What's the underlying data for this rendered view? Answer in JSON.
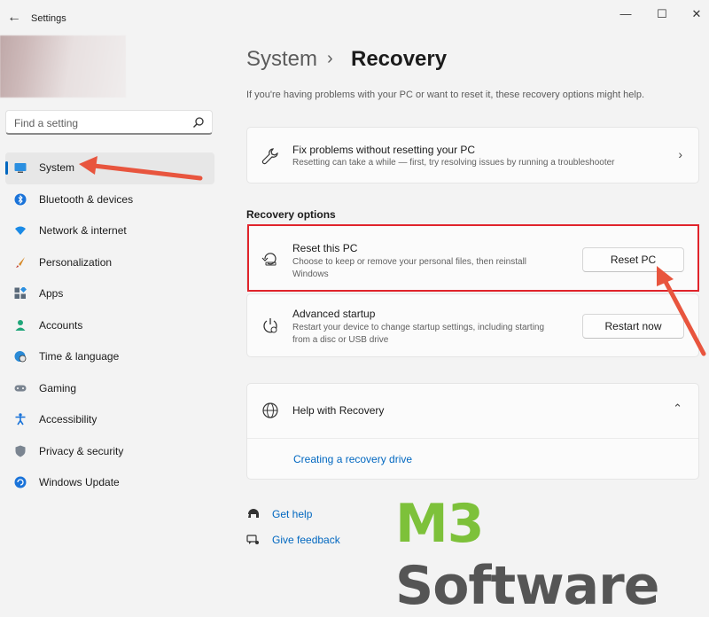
{
  "window": {
    "title": "Settings",
    "back_glyph": "←",
    "minimize_glyph": "—",
    "maximize_glyph": "☐",
    "close_glyph": "✕"
  },
  "search": {
    "placeholder": "Find a setting"
  },
  "sidebar": {
    "items": [
      {
        "label": "System",
        "icon": "monitor-icon",
        "active": true
      },
      {
        "label": "Bluetooth & devices",
        "icon": "bluetooth-icon"
      },
      {
        "label": "Network & internet",
        "icon": "wifi-icon"
      },
      {
        "label": "Personalization",
        "icon": "brush-icon"
      },
      {
        "label": "Apps",
        "icon": "apps-icon"
      },
      {
        "label": "Accounts",
        "icon": "person-icon"
      },
      {
        "label": "Time & language",
        "icon": "globe-clock-icon"
      },
      {
        "label": "Gaming",
        "icon": "gamepad-icon"
      },
      {
        "label": "Accessibility",
        "icon": "accessibility-icon"
      },
      {
        "label": "Privacy & security",
        "icon": "shield-icon"
      },
      {
        "label": "Windows Update",
        "icon": "update-icon"
      }
    ]
  },
  "breadcrumb": {
    "parent": "System",
    "separator": "›",
    "current": "Recovery"
  },
  "intro": "If you're having problems with your PC or want to reset it, these recovery options might help.",
  "fix_card": {
    "title": "Fix problems without resetting your PC",
    "subtitle": "Resetting can take a while — first, try resolving issues by running a troubleshooter",
    "chevron": "›"
  },
  "recovery_options": {
    "heading": "Recovery options",
    "reset": {
      "title": "Reset this PC",
      "subtitle_line1": "Choose to keep or remove your personal files, then reinstall",
      "subtitle_line2": "Windows",
      "button": "Reset PC"
    },
    "advanced": {
      "title": "Advanced startup",
      "subtitle_line1": "Restart your device to change startup settings, including starting",
      "subtitle_line2": "from a disc or USB drive",
      "button": "Restart now"
    }
  },
  "help": {
    "title": "Help with Recovery",
    "chevron": "⌃",
    "link": "Creating a recovery drive"
  },
  "footer": {
    "get_help": "Get help",
    "give_feedback": "Give feedback"
  },
  "watermark": {
    "part1": "M3",
    "part2": " Software"
  },
  "colors": {
    "accent": "#0067c0",
    "highlight_red": "#e0242b",
    "arrow": "#e8553e"
  }
}
